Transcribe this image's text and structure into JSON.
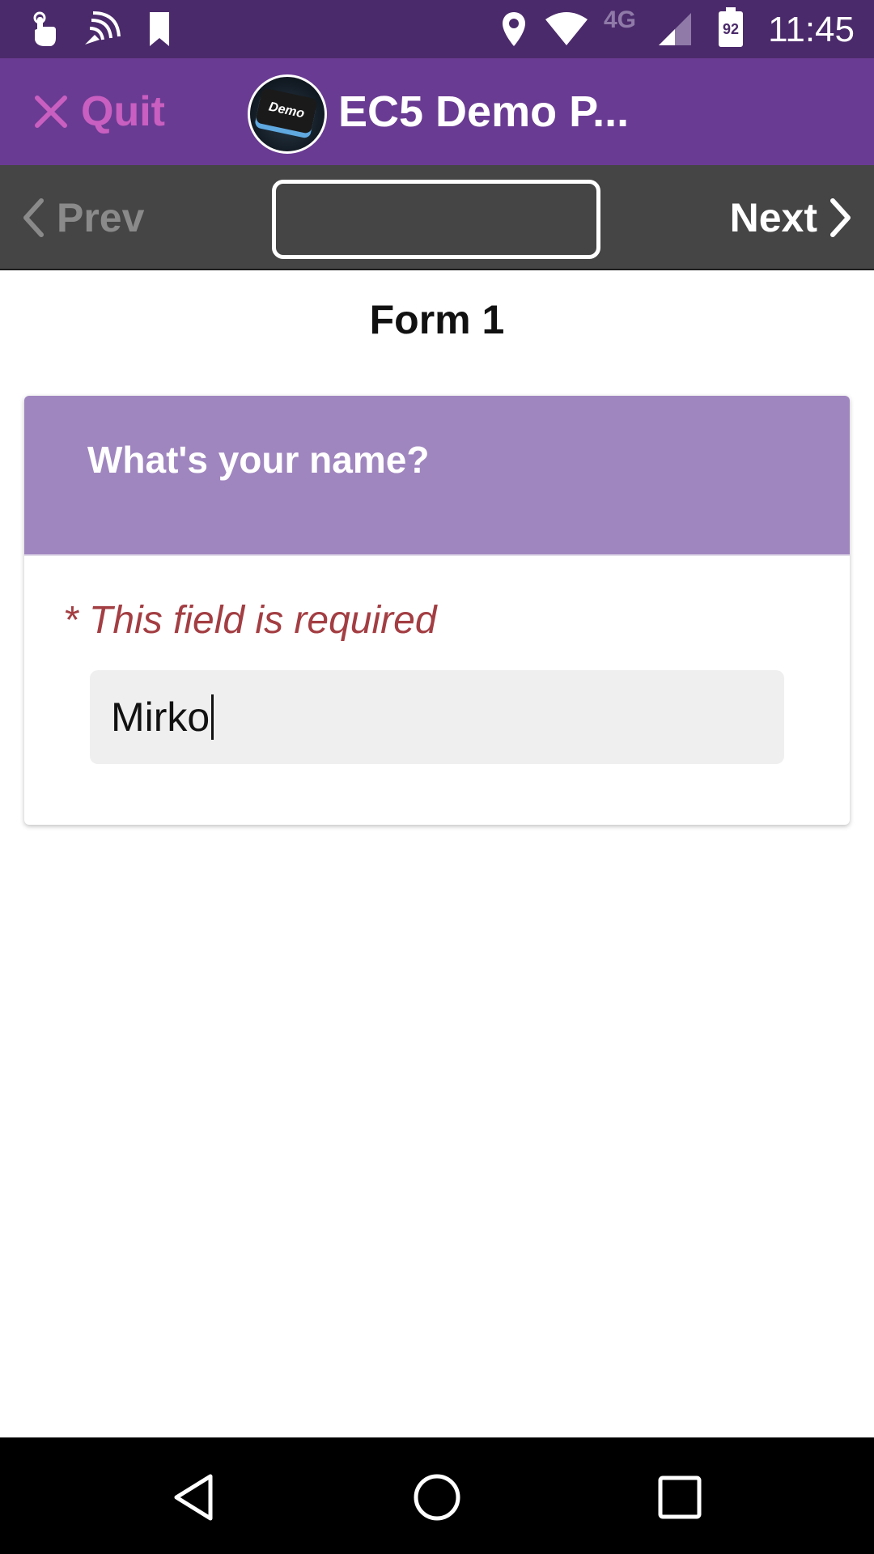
{
  "status_bar": {
    "time": "11:45",
    "network": "4G",
    "battery_level": "92",
    "icons": [
      "touch-icon",
      "cast-icon",
      "bookmark-icon",
      "location-icon",
      "wifi-icon",
      "signal-icon",
      "battery-icon"
    ]
  },
  "app_bar": {
    "quit_label": "Quit",
    "title": "EC5 Demo P...",
    "logo_text": "Demo"
  },
  "nav": {
    "prev_label": "Prev",
    "next_label": "Next",
    "progress": ""
  },
  "form": {
    "title": "Form 1",
    "question": "What's your name?",
    "required_text": "* This field is required",
    "answer_value": "Mirko"
  },
  "colors": {
    "status_bar": "#4b2a6b",
    "app_bar": "#6a3b93",
    "nav_bar": "#454545",
    "question_header": "#a086bf",
    "required_text": "#a33e43",
    "quit": "#c95fc0"
  },
  "system_nav": {
    "icons": [
      "back-icon",
      "home-icon",
      "recents-icon"
    ]
  }
}
